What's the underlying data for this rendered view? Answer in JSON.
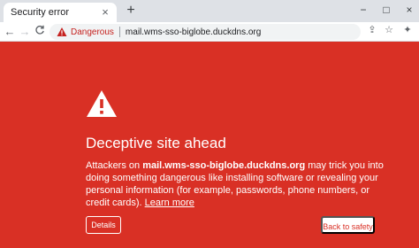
{
  "tab": {
    "title": "Security error",
    "close": "×"
  },
  "newtab": "+",
  "window": {
    "minimize": "−",
    "maximize": "□",
    "close": "×"
  },
  "toolbar": {
    "back": "←",
    "forward": "→",
    "reload": "C",
    "danger_label": "Dangerous",
    "url": "mail.wms-sso-biglobe.duckdns.org",
    "share": "⇪",
    "star": "☆",
    "extension": "✦"
  },
  "page": {
    "headline": "Deceptive site ahead",
    "body_prefix": "Attackers on ",
    "body_domain": "mail.wms-sso-biglobe.duckdns.org",
    "body_suffix": " may trick you into doing something dangerous like installing software or revealing your personal information (for example, passwords, phone numbers, or credit cards). ",
    "learn_more": "Learn more",
    "details_button": "Details",
    "safety_button": "Back to safety"
  },
  "colors": {
    "background": "#d93025",
    "danger_text": "#c5221f"
  }
}
